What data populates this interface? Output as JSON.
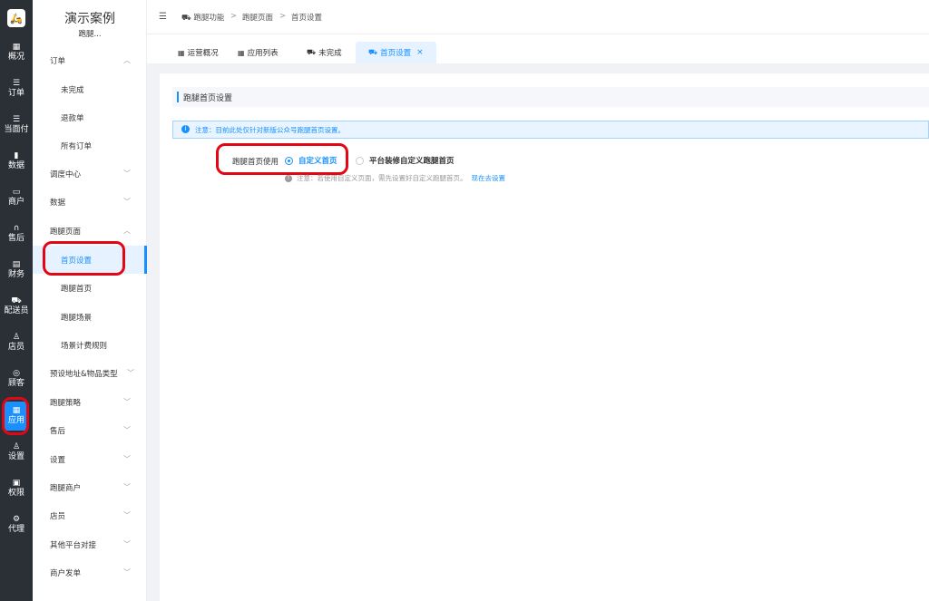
{
  "rail": {
    "logo": "🛵",
    "items": [
      {
        "label": "概况",
        "icon": "dashboard-icon",
        "glyph": "▦"
      },
      {
        "label": "订单",
        "icon": "list-icon",
        "glyph": "☰"
      },
      {
        "label": "当面付",
        "icon": "list-icon",
        "glyph": "☰"
      },
      {
        "label": "数据",
        "icon": "bar-chart-icon",
        "glyph": "▮"
      },
      {
        "label": "商户",
        "icon": "store-icon",
        "glyph": "▭"
      },
      {
        "label": "售后",
        "icon": "headset-icon",
        "glyph": "∩"
      },
      {
        "label": "财务",
        "icon": "book-icon",
        "glyph": "▤"
      },
      {
        "label": "配送员",
        "icon": "courier-icon",
        "glyph": "⛟"
      },
      {
        "label": "店员",
        "icon": "users-icon",
        "glyph": "♙"
      },
      {
        "label": "顾客",
        "icon": "customer-icon",
        "glyph": "◎"
      },
      {
        "label": "应用",
        "icon": "apps-icon",
        "glyph": "▦"
      },
      {
        "label": "设置",
        "icon": "user-settings-icon",
        "glyph": "♙"
      },
      {
        "label": "权限",
        "icon": "lock-icon",
        "glyph": "▣"
      },
      {
        "label": "代理",
        "icon": "gear-icon",
        "glyph": "⚙"
      }
    ]
  },
  "sidebar": {
    "title": "演示案例",
    "subtitle": "跑腿...",
    "items": [
      {
        "label": "订单",
        "chevron": "︿"
      },
      {
        "label": "未完成"
      },
      {
        "label": "退款单"
      },
      {
        "label": "所有订单"
      },
      {
        "label": "调度中心",
        "chevron": "﹀"
      },
      {
        "label": "数据",
        "chevron": "﹀"
      },
      {
        "label": "跑腿页面",
        "chevron": "︿"
      },
      {
        "label": "首页设置"
      },
      {
        "label": "跑腿首页"
      },
      {
        "label": "跑腿场景"
      },
      {
        "label": "场景计费规则"
      },
      {
        "label": "预设地址&物品类型",
        "chevron": "﹀"
      },
      {
        "label": "跑腿策略",
        "chevron": "﹀"
      },
      {
        "label": "售后",
        "chevron": "﹀"
      },
      {
        "label": "设置",
        "chevron": "﹀"
      },
      {
        "label": "跑腿商户",
        "chevron": "﹀"
      },
      {
        "label": "店员",
        "chevron": "﹀"
      },
      {
        "label": "其他平台对接",
        "chevron": "﹀"
      },
      {
        "label": "商户发单",
        "chevron": "﹀"
      }
    ]
  },
  "header": {
    "breadcrumb": [
      "跑腿功能",
      "跑腿页面",
      "首页设置"
    ],
    "separator": ">"
  },
  "tabs": [
    {
      "label": "运营概况",
      "icon": "dashboard-icon"
    },
    {
      "label": "应用列表",
      "icon": "apps-icon"
    },
    {
      "label": "未完成",
      "icon": "courier-icon"
    },
    {
      "label": "首页设置",
      "icon": "courier-icon",
      "close": "×"
    }
  ],
  "main": {
    "section_title": "跑腿首页设置",
    "notice": "注意：目前此处仅针对新版公众号跑腿首页设置。",
    "form_label": "跑腿首页使用",
    "options": [
      {
        "label": "自定义首页",
        "checked": true
      },
      {
        "label": "平台装修自定义跑腿首页",
        "checked": false
      }
    ],
    "hint": "注意：若使用自定义页面，需先设置好自定义跑腿首页。",
    "hint_link": "现在去设置"
  },
  "colors": {
    "accent": "#1890ff",
    "rail_bg": "#2b2f36",
    "highlight": "#e30613"
  }
}
